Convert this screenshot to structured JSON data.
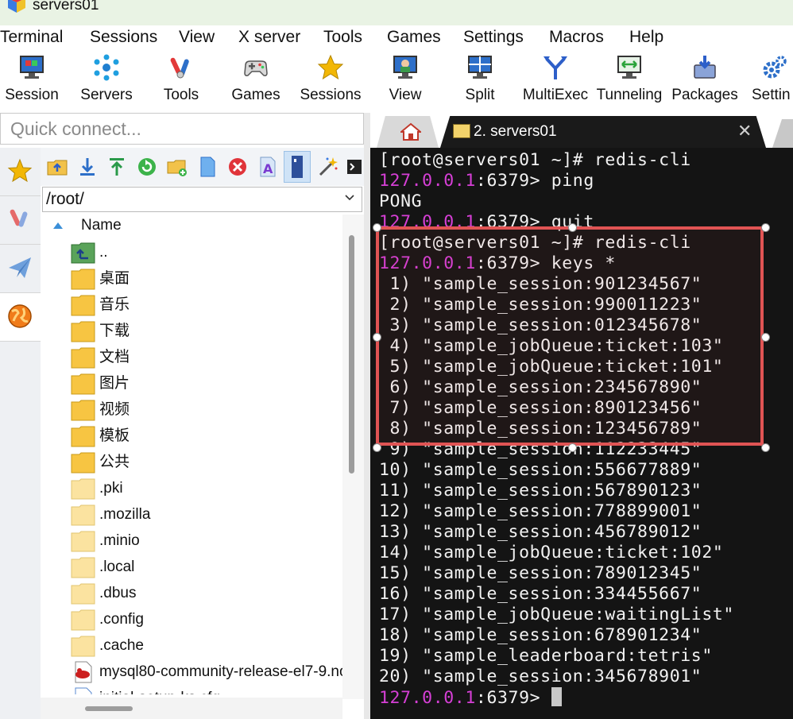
{
  "window": {
    "title": "servers01"
  },
  "menu": [
    "Terminal",
    "Sessions",
    "View",
    "X server",
    "Tools",
    "Games",
    "Settings",
    "Macros",
    "Help"
  ],
  "toolbar": {
    "buttons": [
      {
        "label": "Session",
        "icon": "monitor-icon"
      },
      {
        "label": "Servers",
        "icon": "servers-icon"
      },
      {
        "label": "Tools",
        "icon": "swiss-knife-icon"
      },
      {
        "label": "Games",
        "icon": "gamepad-icon"
      },
      {
        "label": "Sessions",
        "icon": "star-icon"
      },
      {
        "label": "View",
        "icon": "view-icon"
      },
      {
        "label": "Split",
        "icon": "split-icon"
      },
      {
        "label": "MultiExec",
        "icon": "multiexec-icon"
      },
      {
        "label": "Tunneling",
        "icon": "tunneling-icon"
      },
      {
        "label": "Packages",
        "icon": "packages-icon"
      },
      {
        "label": "Settin",
        "icon": "gears-icon"
      }
    ]
  },
  "quick_connect": {
    "placeholder": "Quick connect..."
  },
  "sftp": {
    "path": "/root/",
    "column_header": "Name",
    "files": [
      {
        "name": "..",
        "type": "up"
      },
      {
        "name": "桌面",
        "type": "folder"
      },
      {
        "name": "音乐",
        "type": "folder"
      },
      {
        "name": "下载",
        "type": "folder"
      },
      {
        "name": "文档",
        "type": "folder"
      },
      {
        "name": "图片",
        "type": "folder"
      },
      {
        "name": "视频",
        "type": "folder"
      },
      {
        "name": "模板",
        "type": "folder"
      },
      {
        "name": "公共",
        "type": "folder"
      },
      {
        "name": ".pki",
        "type": "hidden-folder"
      },
      {
        "name": ".mozilla",
        "type": "hidden-folder"
      },
      {
        "name": ".minio",
        "type": "hidden-folder"
      },
      {
        "name": ".local",
        "type": "hidden-folder"
      },
      {
        "name": ".dbus",
        "type": "hidden-folder"
      },
      {
        "name": ".config",
        "type": "hidden-folder"
      },
      {
        "name": ".cache",
        "type": "hidden-folder"
      },
      {
        "name": "mysql80-community-release-el7-9.no",
        "type": "rpm"
      },
      {
        "name": "initial-setup-ks.cfg",
        "type": "file"
      }
    ]
  },
  "tabs": {
    "session_label": "2. servers01",
    "close_glyph": "✕"
  },
  "terminal": {
    "colors": {
      "background": "#141414",
      "text": "#f2f2f2",
      "ip": "#d63fd6",
      "selection": "#e05454"
    },
    "lines": [
      {
        "plain": "[root@servers01 ~]# redis-cli"
      },
      {
        "ip": "127.0.0.1",
        "rest": ":6379> ping"
      },
      {
        "plain": "PONG"
      },
      {
        "ip": "127.0.0.1",
        "rest": ":6379> quit"
      },
      {
        "plain": "[root@servers01 ~]# redis-cli"
      },
      {
        "ip": "127.0.0.1",
        "rest": ":6379> keys *"
      },
      {
        "plain": " 1) \"sample_session:901234567\""
      },
      {
        "plain": " 2) \"sample_session:990011223\""
      },
      {
        "plain": " 3) \"sample_session:012345678\""
      },
      {
        "plain": " 4) \"sample_jobQueue:ticket:103\""
      },
      {
        "plain": " 5) \"sample_jobQueue:ticket:101\""
      },
      {
        "plain": " 6) \"sample_session:234567890\""
      },
      {
        "plain": " 7) \"sample_session:890123456\""
      },
      {
        "plain": " 8) \"sample_session:123456789\""
      },
      {
        "plain": " 9) \"sample_session:112233445\""
      },
      {
        "plain": "10) \"sample_session:556677889\""
      },
      {
        "plain": "11) \"sample_session:567890123\""
      },
      {
        "plain": "12) \"sample_session:778899001\""
      },
      {
        "plain": "13) \"sample_session:456789012\""
      },
      {
        "plain": "14) \"sample_jobQueue:ticket:102\""
      },
      {
        "plain": "15) \"sample_session:789012345\""
      },
      {
        "plain": "16) \"sample_session:334455667\""
      },
      {
        "plain": "17) \"sample_jobQueue:waitingList\""
      },
      {
        "plain": "18) \"sample_session:678901234\""
      },
      {
        "plain": "19) \"sample_leaderboard:tetris\""
      },
      {
        "plain": "20) \"sample_session:345678901\""
      }
    ],
    "prompt": {
      "ip": "127.0.0.1",
      "rest": ":6379> "
    }
  }
}
